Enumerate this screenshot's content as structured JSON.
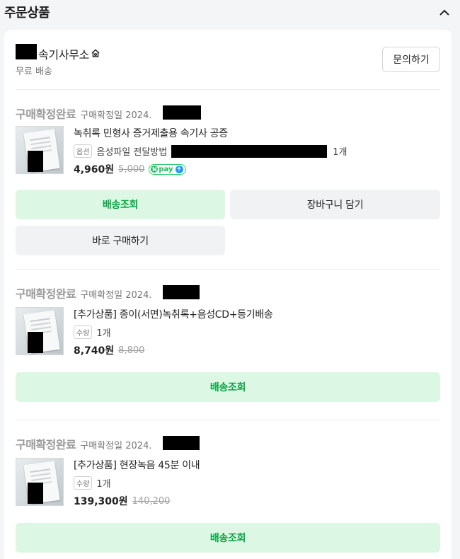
{
  "header": {
    "title": "주문상품"
  },
  "seller": {
    "name": "속기사무소",
    "shipping": "무료 배송",
    "inquiry_label": "문의하기"
  },
  "orders": [
    {
      "status": "구매확정완료",
      "confirm_label": "구매확정일 2024.",
      "product_name": "녹취록 민형사 증거제출용 속기사 공증",
      "option_badge": "옵션",
      "option_text": "음성파일 전달방법",
      "quantity": "1개",
      "price": "4,960원",
      "original_price": "5,000",
      "npay_label": "pay",
      "buttons": {
        "track": "배송조회",
        "cart": "장바구니 담기",
        "buy_now": "바로 구매하기"
      }
    },
    {
      "status": "구매확정완료",
      "confirm_label": "구매확정일 2024.",
      "product_name": "[추가상품] 종이(서면)녹취록+음성CD+등기배송",
      "option_badge": "수량",
      "quantity": "1개",
      "price": "8,740원",
      "original_price": "8,800",
      "buttons": {
        "track": "배송조회"
      }
    },
    {
      "status": "구매확정완료",
      "confirm_label": "구매확정일 2024.",
      "product_name": "[추가상품] 현장녹음 45분 이내",
      "option_badge": "수량",
      "quantity": "1개",
      "price": "139,300원",
      "original_price": "140,200",
      "buttons": {
        "track": "배송조회"
      }
    }
  ]
}
